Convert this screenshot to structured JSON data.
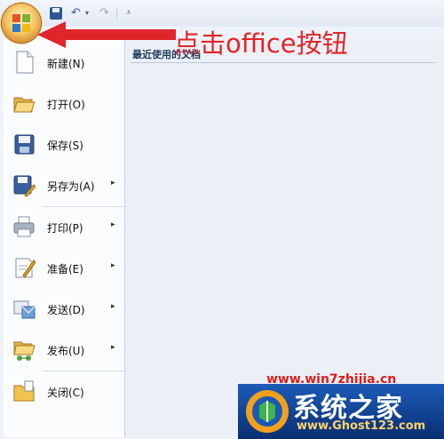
{
  "annotation": "点击office按钮",
  "menu": {
    "recent_title": "最近使用的文档",
    "items": [
      {
        "label": "新建(N)",
        "icon": "new-document-icon",
        "submenu": false
      },
      {
        "label": "打开(O)",
        "icon": "open-folder-icon",
        "submenu": false
      },
      {
        "label": "保存(S)",
        "icon": "save-disk-icon",
        "submenu": false
      },
      {
        "label": "另存为(A)",
        "icon": "save-as-icon",
        "submenu": true,
        "arrow": "▸"
      },
      {
        "label": "打印(P)",
        "icon": "printer-icon",
        "submenu": true,
        "arrow": "▸"
      },
      {
        "label": "准备(E)",
        "icon": "prepare-icon",
        "submenu": true,
        "arrow": "▸"
      },
      {
        "label": "发送(D)",
        "icon": "send-icon",
        "submenu": true,
        "arrow": "▸"
      },
      {
        "label": "发布(U)",
        "icon": "publish-icon",
        "submenu": true,
        "arrow": "▸"
      },
      {
        "label": "关闭(C)",
        "icon": "close-folder-icon",
        "submenu": false
      }
    ]
  },
  "toolbar": {
    "undo_glyph": "↶",
    "undo_dropdown": "▾",
    "redo_glyph": "↷",
    "customize_glyph": "⩡"
  },
  "watermark": {
    "url_top": "www.win7zhijia.cn",
    "name": "系统之家",
    "url": "www.Ghost123.com"
  },
  "colors": {
    "annotation_red": "#e0262b",
    "menu_background": "#eef3fa",
    "recent_panel": "#ecf0f6"
  }
}
